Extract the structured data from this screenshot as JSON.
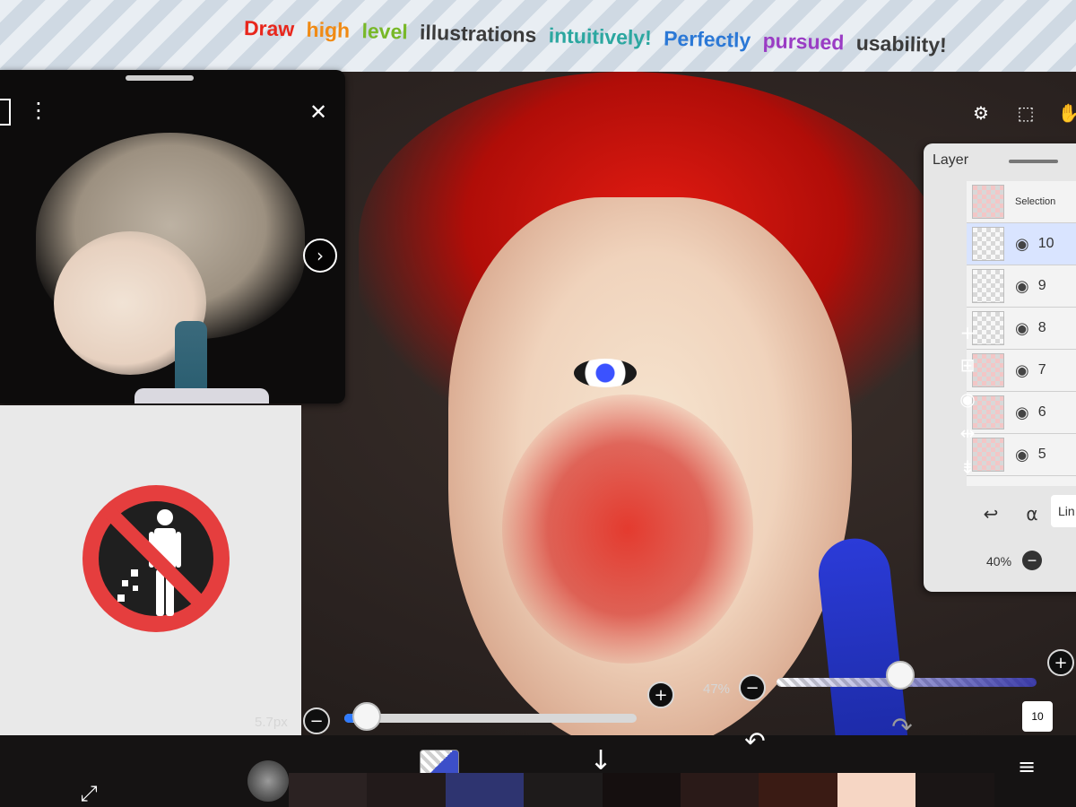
{
  "banner": {
    "words": [
      {
        "text": "Draw",
        "color": "#e8261c"
      },
      {
        "text": "high",
        "color": "#f08a14"
      },
      {
        "text": "level",
        "color": "#78b828"
      },
      {
        "text": "illustrations",
        "color": "#3b3b3b"
      },
      {
        "text": "intuitively!",
        "color": "#2ca7a0"
      },
      {
        "text": "Perfectly",
        "color": "#2b78d6"
      },
      {
        "text": "pursued",
        "color": "#9a3cc4"
      },
      {
        "text": "usability!",
        "color": "#3b3b3b"
      }
    ]
  },
  "reference_window": {
    "close_icon": "✕",
    "menu_icon": "⋮",
    "next_icon": "›"
  },
  "layer_panel": {
    "title": "Layer",
    "selection_label": "Selection",
    "layers": [
      "10",
      "9",
      "8",
      "7",
      "6",
      "5"
    ],
    "selected_layer": "10",
    "blend_mode": "Lin",
    "opacity": "40%"
  },
  "layer_tools": {
    "add": "+",
    "add_layer": "⊞",
    "camera": "◉",
    "flip": "⇹",
    "merge": "⇟",
    "undo_arrow": "↩",
    "lock": "α"
  },
  "brush_size": {
    "label": "5.7px",
    "minus": "−",
    "plus": "+",
    "value_fraction": 0.04
  },
  "brush_opacity": {
    "label": "47%",
    "minus": "−",
    "plus": "+",
    "value_fraction": 0.47
  },
  "bottom_bar": {
    "arrow_down": "↓",
    "undo": "↶",
    "redo": "↷",
    "menu": "≡",
    "layer_count": "10",
    "transform_icon": "⤢",
    "swatches": [
      "#2b2222",
      "#221a1a",
      "#2e3470",
      "#1e1b1b",
      "#150f0f",
      "#2a1a18",
      "#3a1b14",
      "#f6d6c4",
      "#1a1515"
    ]
  }
}
